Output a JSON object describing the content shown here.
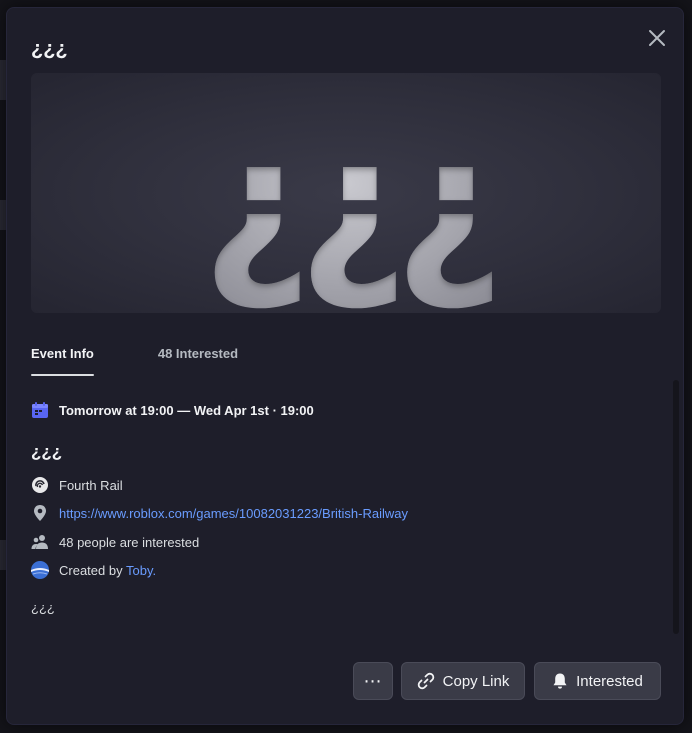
{
  "modal": {
    "title": "¿¿¿",
    "cover_text": "¿¿¿"
  },
  "tabs": [
    {
      "label": "Event Info",
      "active": true
    },
    {
      "label": "48 Interested",
      "active": false
    }
  ],
  "event": {
    "when": "Tomorrow at 19:00 — Wed Apr 1st · 19:00",
    "name": "¿¿¿",
    "server": "Fourth Rail",
    "location_url": "https://www.roblox.com/games/10082031223/British-Railway",
    "interested_text": "48 people are interested",
    "created_by_prefix": "Created by",
    "creator": "Toby.",
    "description": "¿¿¿"
  },
  "buttons": {
    "more_label": "⋯",
    "copy_link_label": "Copy Link",
    "interested_label": "Interested"
  },
  "colors": {
    "accent": "#5865f2",
    "link": "#6a9cff",
    "modal_bg": "#1e1e2a"
  }
}
